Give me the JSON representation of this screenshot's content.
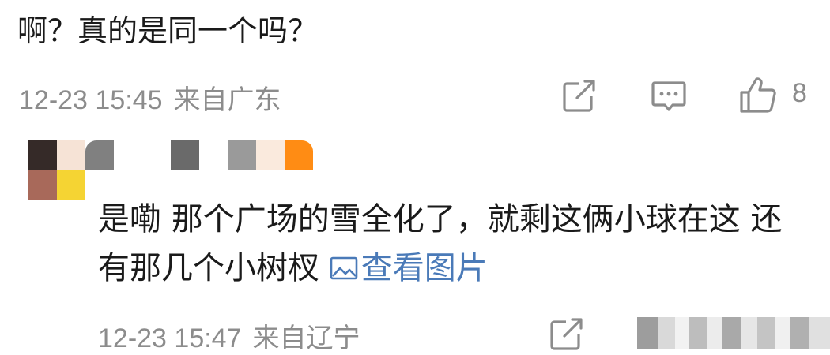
{
  "parent_comment": {
    "text": "啊？真的是同一个吗？",
    "timestamp": "12-23 15:45",
    "location": "来自广东",
    "like_count": "8"
  },
  "reply": {
    "text": "是嘞 那个广场的雪全化了，就剩这俩小球在这 还有那几个小树杈",
    "view_image_label": "查看图片",
    "timestamp": "12-23 15:47",
    "location": "来自辽宁"
  },
  "icons": {
    "share": "share-icon",
    "comment": "comment-icon",
    "like": "thumbs-up-icon",
    "image": "image-icon"
  },
  "colors": {
    "text": "#1a1a1a",
    "meta": "#8c8c8c",
    "link": "#4a7ab8",
    "icon": "#8c8c8c"
  }
}
